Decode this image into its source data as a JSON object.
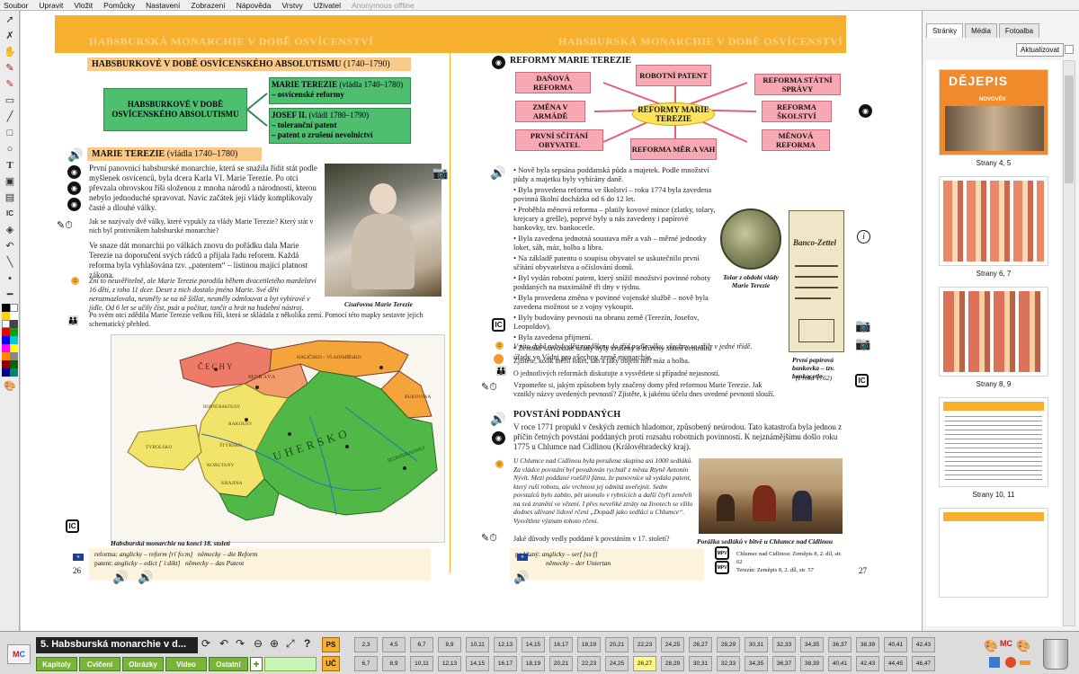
{
  "menu": [
    "Soubor",
    "Upravit",
    "Vložit",
    "Pomůcky",
    "Nastavení",
    "Zobrazení",
    "Nápověda",
    "Vrstvy",
    "Uživatel",
    "Anonymous offline"
  ],
  "left_page": {
    "band_title": "HABSBURSKÁ MONARCHIE V DOBĚ OSVÍCENSTVÍ",
    "section_title": "HABSBURKOVÉ V DOBĚ OSVÍCENSKÉHO ABSOLUTISMU",
    "section_years": "(1740–1790)",
    "diagram": {
      "root": "HABSBURKOVÉ V DOBĚ OSVÍCENSKÉHO ABSOLUTISMU",
      "b1_name": "MARIE TEREZIE",
      "b1_years": "(vládla 1740–1780)",
      "b1_sub": "– osvícenské reformy",
      "b2_name": "JOSEF II.",
      "b2_years": "(vládl 1780–1790)",
      "b2_sub1": "– toleranční patent",
      "b2_sub2": "– patent o zrušení nevolnictví"
    },
    "mt_title": "MARIE TEREZIE",
    "mt_years": "(vládla 1740–1780)",
    "para1": "První panovnicí habsburské monarchie, která se snažila řídit stát podle myšlenek osvícenců, byla dcera Karla VI. Marie Terezie. Po otci převzala obrovskou říši složenou z mnoha národů a národností, kterou nebylo jednoduché spravovat. Navíc začátek její vlády komplikovaly časté a dlouhé války.",
    "question1": "Jak se nazývaly dvě války, které vypukly za vlády Marie Terezie? Který stát v nich byl protivníkem habsburské monarchie?",
    "para2": "Ve snaze dát monarchii po válkách znovu do pořádku dala Marie Terezie na doporučení svých rádců a přijala řadu reforem. Každá reforma byla vyhlašována tzv. „patentem“ – listinou mající platnost zákona.",
    "italic1": "Zní to neuvěřitelně, ale Marie Terezie porodila během dvacetiletého manželství 16 dětí, z toho 11 dcer. Deset z nich dostalo jméno Marie. Své děti nerozmazlovala, nesměly se na ně šišlat, nesměly odmlouvat a byt vybíravé v jídle. Od 6 let se učily číst, psát a počítat, tančit a hrát na hudební nástroj.",
    "para3": "Po svém otci zdědila Marie Terezie velkou říši, která se skládala z několika zemí. Pomocí této mapky sestavte jejich schematický přehled.",
    "portrait_caption": "Císařovna Marie Terezie",
    "map_labels": {
      "cechy": "ČECHY",
      "morava": "MORAVA",
      "halic": "HALIČSKO – VLADIMÍŘSKO",
      "bukovina": "BUKOVINA",
      "uhersko": "UHERSKO",
      "sedmihr": "SEDMIHRADSKO",
      "rakousy": "RAKOUSY",
      "styrsko": "ŠTÝRSKO",
      "korutany": "KORUTANY",
      "krajina": "KRAJINA",
      "tyrolsko": "TYROLSKO",
      "hor_rak": "HORNÍ RAKOUSY"
    },
    "map_caption": "Habsburská monarchie na konci 18. století",
    "footer_line1_a": "reforma:",
    "footer_line1_b": "anglicky – reform [riˈfoːm]",
    "footer_line1_c": "německy – die Reform",
    "footer_line2_a": "patent:",
    "footer_line2_b": "anglicky – edict [ˈiːdikt]",
    "footer_line2_c": "německy – das Patent",
    "page_number": "26"
  },
  "right_page": {
    "band_title": "HABSBURSKÁ MONARCHIE V DOBĚ OSVÍCENSTVÍ",
    "reforms_title": "REFORMY MARIE TEREZIE",
    "center": "REFORMY MARIE TEREZIE",
    "r_dan": "DAŇOVÁ REFORMA",
    "r_patent": "ROBOTNÍ PATENT",
    "r_statni": "REFORMA STÁTNÍ SPRÁVY",
    "r_armada": "ZMĚNA V ARMÁDĚ",
    "r_skolstvi": "REFORMA ŠKOLSTVÍ",
    "r_scitani": "PRVNÍ SČÍTÁNÍ OBYVATEL",
    "r_mer": "REFORMA MĚR A VAH",
    "r_mena": "MĚNOVÁ REFORMA",
    "bullets": [
      "Nově byla sepsána poddanská půda a majetek. Podle množství půdy a majetku byly vybírány daně.",
      "Byla provedena reforma ve školství – roku 1774 byla zavedena povinná školní docházka od 6 do 12 let.",
      "Proběhla měnová reforma – platily kovové mince (zlatky, tolary, krejcary a grešle), poprvé byly u nás zavedeny i papírové bankovky, tzv. bankocetle.",
      "Byla zavedena jednotná soustava měr a vah – měrné jednotky loket, sáh, máz, holba a libra.",
      "Na základě patentu o soupisu obyvatel se uskutečnilo první sčítání obyvatelstva a očíslování domů.",
      "Byl vydán robotní patent, který snížil množství povinné roboty poddaných na maximálně tři dny v týdnu.",
      "Byla provedena změna v povinné vojenské službě – nově byla zavedena možnost se z vojny vykoupit.",
      "Byly budovány pevnosti na obranu země (Terezín, Josefov, Leopoldov).",
      "Byla zavedena přijmení.",
      "Zemské stavovské úřady byly zrušeny a zřízeny státní centrální úřady ve Vídni pro všechny země monarchie."
    ],
    "coin_caption": "Tolar z období vlády Marie Terezie",
    "note_caption1": "První papírová bankovka – tzv. bankocetle",
    "note_caption2": "(z roku 1762)",
    "note_text": "Banco-Zettel",
    "italic2": "V této době nebyly děti rozděleny do tříd podle věku, všechny se učily v jedné třídě.",
    "q2": "Zjistěte, kolik měřil loket, sáh a jaký objem měl máz a holba.",
    "q3": "O jednotlivých reformách diskutujte a vysvětlete si případné nejasnosti.",
    "q4": "Vzpomeňte si, jakým způsobem byly značeny domy před reformou Marie Terezie. Jak vznikly názvy uvedených pevností? Zjistěte, k jakému účelu dnes uvedené pevnosti slouží.",
    "uprising_title": "POVSTÁNÍ PODDANÝCH",
    "uprising_text": "V roce 1771 propukl v českých zemích hladomor, způsobený neúrodou. Tato katastrofa byla jednou z příčin četných povstání poddaných proti rozsahu robotních povinností. K nejznámějšímu došlo roku 1775 u Chlumce nad Cidlinou (Královéhradecký kraj).",
    "uprising_italic": "U Chlumce nad Cidlinou byla poražena skupina asi 1000 sedláků. Za vládce povstání byl považován rychtář z města Rtyně Antonín Nývlt. Mezi poddané rozšířil fámu, že panovníce už vydala patent, který ruší robotu, ale vrchnost jej odmítá uveřejnit. Sedm povstalců bylo zabito, pět utonulo v rybnících a další čtyři zemřeli na svá zranění ve vězení. I přes neveliké ztráty na životech se vžilo dodnes užívané lidové rčení „Dopadl jako sedláci u Chlumce“. Vysvětlete význam tohoto rčení.",
    "battle_caption": "Porážka sedláků v bitvě u Chlumce nad Cidlinou",
    "q5": "Jaké důvody vedly poddané k povstáním v 17. století?",
    "footer_a": "poddaný:",
    "footer_b": "anglicky – serf [sɜːf]",
    "footer_c": "německy – der Untertan",
    "mpv1": "Chlumec nad Cidlinou: Zeměpis 8, 2. díl, str. 62",
    "mpv2": "Terezín: Zeměpis 8, 2. díl, str. 57",
    "page_number": "27"
  },
  "panel": {
    "tabs": [
      "Stránky",
      "Média",
      "Fotoalba"
    ],
    "update_button": "Aktualizovat",
    "cover_title": "DĚJEPIS",
    "cover_subtitle": "NOVOVĚK",
    "thumbs": [
      "Strany 4, 5",
      "Strany 6, 7",
      "Strany 8, 9",
      "Strany 10, 11"
    ]
  },
  "bottom": {
    "title": "5. Habsburská monarchie v d...",
    "nav_buttons": [
      "Kapitoly",
      "Cvičení",
      "Obrázky",
      "Video",
      "Ostatní"
    ],
    "ps": "PS",
    "uc": "UČ",
    "ps_pages": [
      "2,3",
      "4,5",
      "6,7",
      "8,9",
      "10,11",
      "12,13",
      "14,15",
      "16,17",
      "18,19",
      "20,21",
      "22,23",
      "24,25",
      "26,27",
      "28,29",
      "30,31",
      "32,33",
      "34,35",
      "36,37",
      "38,39",
      "40,41",
      "42,43"
    ],
    "uc_pages": [
      "6,7",
      "8,9",
      "10,11",
      "12,13",
      "14,15",
      "16,17",
      "18,19",
      "20,21",
      "22,23",
      "24,25",
      "26,27",
      "28,29",
      "30,31",
      "32,33",
      "34,35",
      "36,37",
      "38,39",
      "40,41",
      "42,43",
      "44,45",
      "46,47"
    ],
    "uc_selected": "26,27"
  },
  "colors": {
    "band": "#f7b02e",
    "green_box": "#4dbf6f",
    "pink_box": "#f6a9b3",
    "yellow_center": "#fce45a",
    "nav_green": "#7bb43a"
  }
}
